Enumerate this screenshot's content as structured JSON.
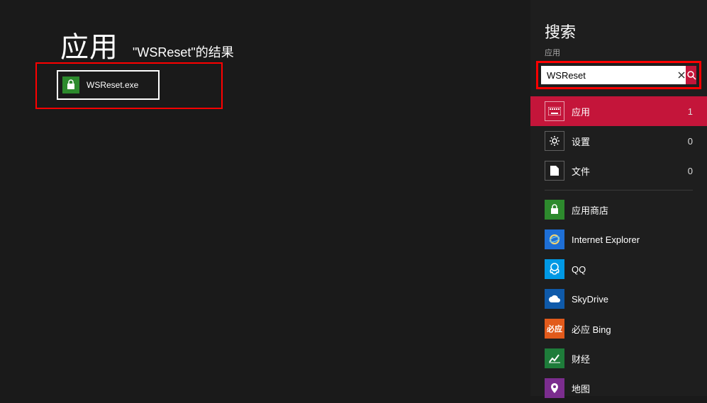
{
  "main": {
    "title": "应用",
    "subtitle_prefix": "\"",
    "subtitle_query": "WSReset",
    "subtitle_suffix": "\"的结果",
    "result": {
      "label": "WSReset.exe",
      "icon": "store-icon"
    }
  },
  "search": {
    "title": "搜索",
    "scope": "应用",
    "input_value": "WSReset",
    "categories": [
      {
        "id": "apps",
        "label": "应用",
        "count": "1",
        "icon": "keyboard-icon",
        "active": true
      },
      {
        "id": "settings",
        "label": "设置",
        "count": "0",
        "icon": "gear-icon",
        "active": false
      },
      {
        "id": "files",
        "label": "文件",
        "count": "0",
        "icon": "file-icon",
        "active": false
      }
    ],
    "apps": [
      {
        "id": "store",
        "label": "应用商店",
        "icon": "store-icon",
        "bg": "#2d8a2d"
      },
      {
        "id": "ie",
        "label": "Internet Explorer",
        "icon": "ie-icon",
        "bg": "#1e6fd6"
      },
      {
        "id": "qq",
        "label": "QQ",
        "icon": "qq-icon",
        "bg": "#0099e5"
      },
      {
        "id": "skydrive",
        "label": "SkyDrive",
        "icon": "cloud-icon",
        "bg": "#0f5aaa"
      },
      {
        "id": "bing",
        "label": "必应 Bing",
        "icon": "bing-icon",
        "bg": "#e25a1b"
      },
      {
        "id": "finance",
        "label": "财经",
        "icon": "finance-icon",
        "bg": "#1e7c3a"
      },
      {
        "id": "map",
        "label": "地图",
        "icon": "map-icon",
        "bg": "#7b2d8e"
      }
    ]
  }
}
